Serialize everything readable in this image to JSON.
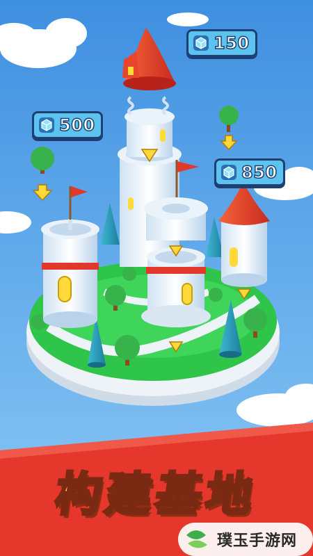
{
  "game": {
    "banner_title": "构建基地",
    "currency_icon": "gem-cube-icon",
    "price_tags": [
      {
        "id": "top-tower",
        "value": "150"
      },
      {
        "id": "left-tower",
        "value": "500"
      },
      {
        "id": "right-tower",
        "value": "850"
      }
    ]
  },
  "watermark": {
    "text": "璞玉手游网"
  },
  "colors": {
    "sky": "#5aa8ee",
    "banner_red": "#e5372b",
    "banner_text": "#ffd64a",
    "tag_fill": "#5cc2ee",
    "tag_outline": "#1d3f72",
    "grass": "#2fc54a",
    "roof_red": "#e8452e"
  }
}
